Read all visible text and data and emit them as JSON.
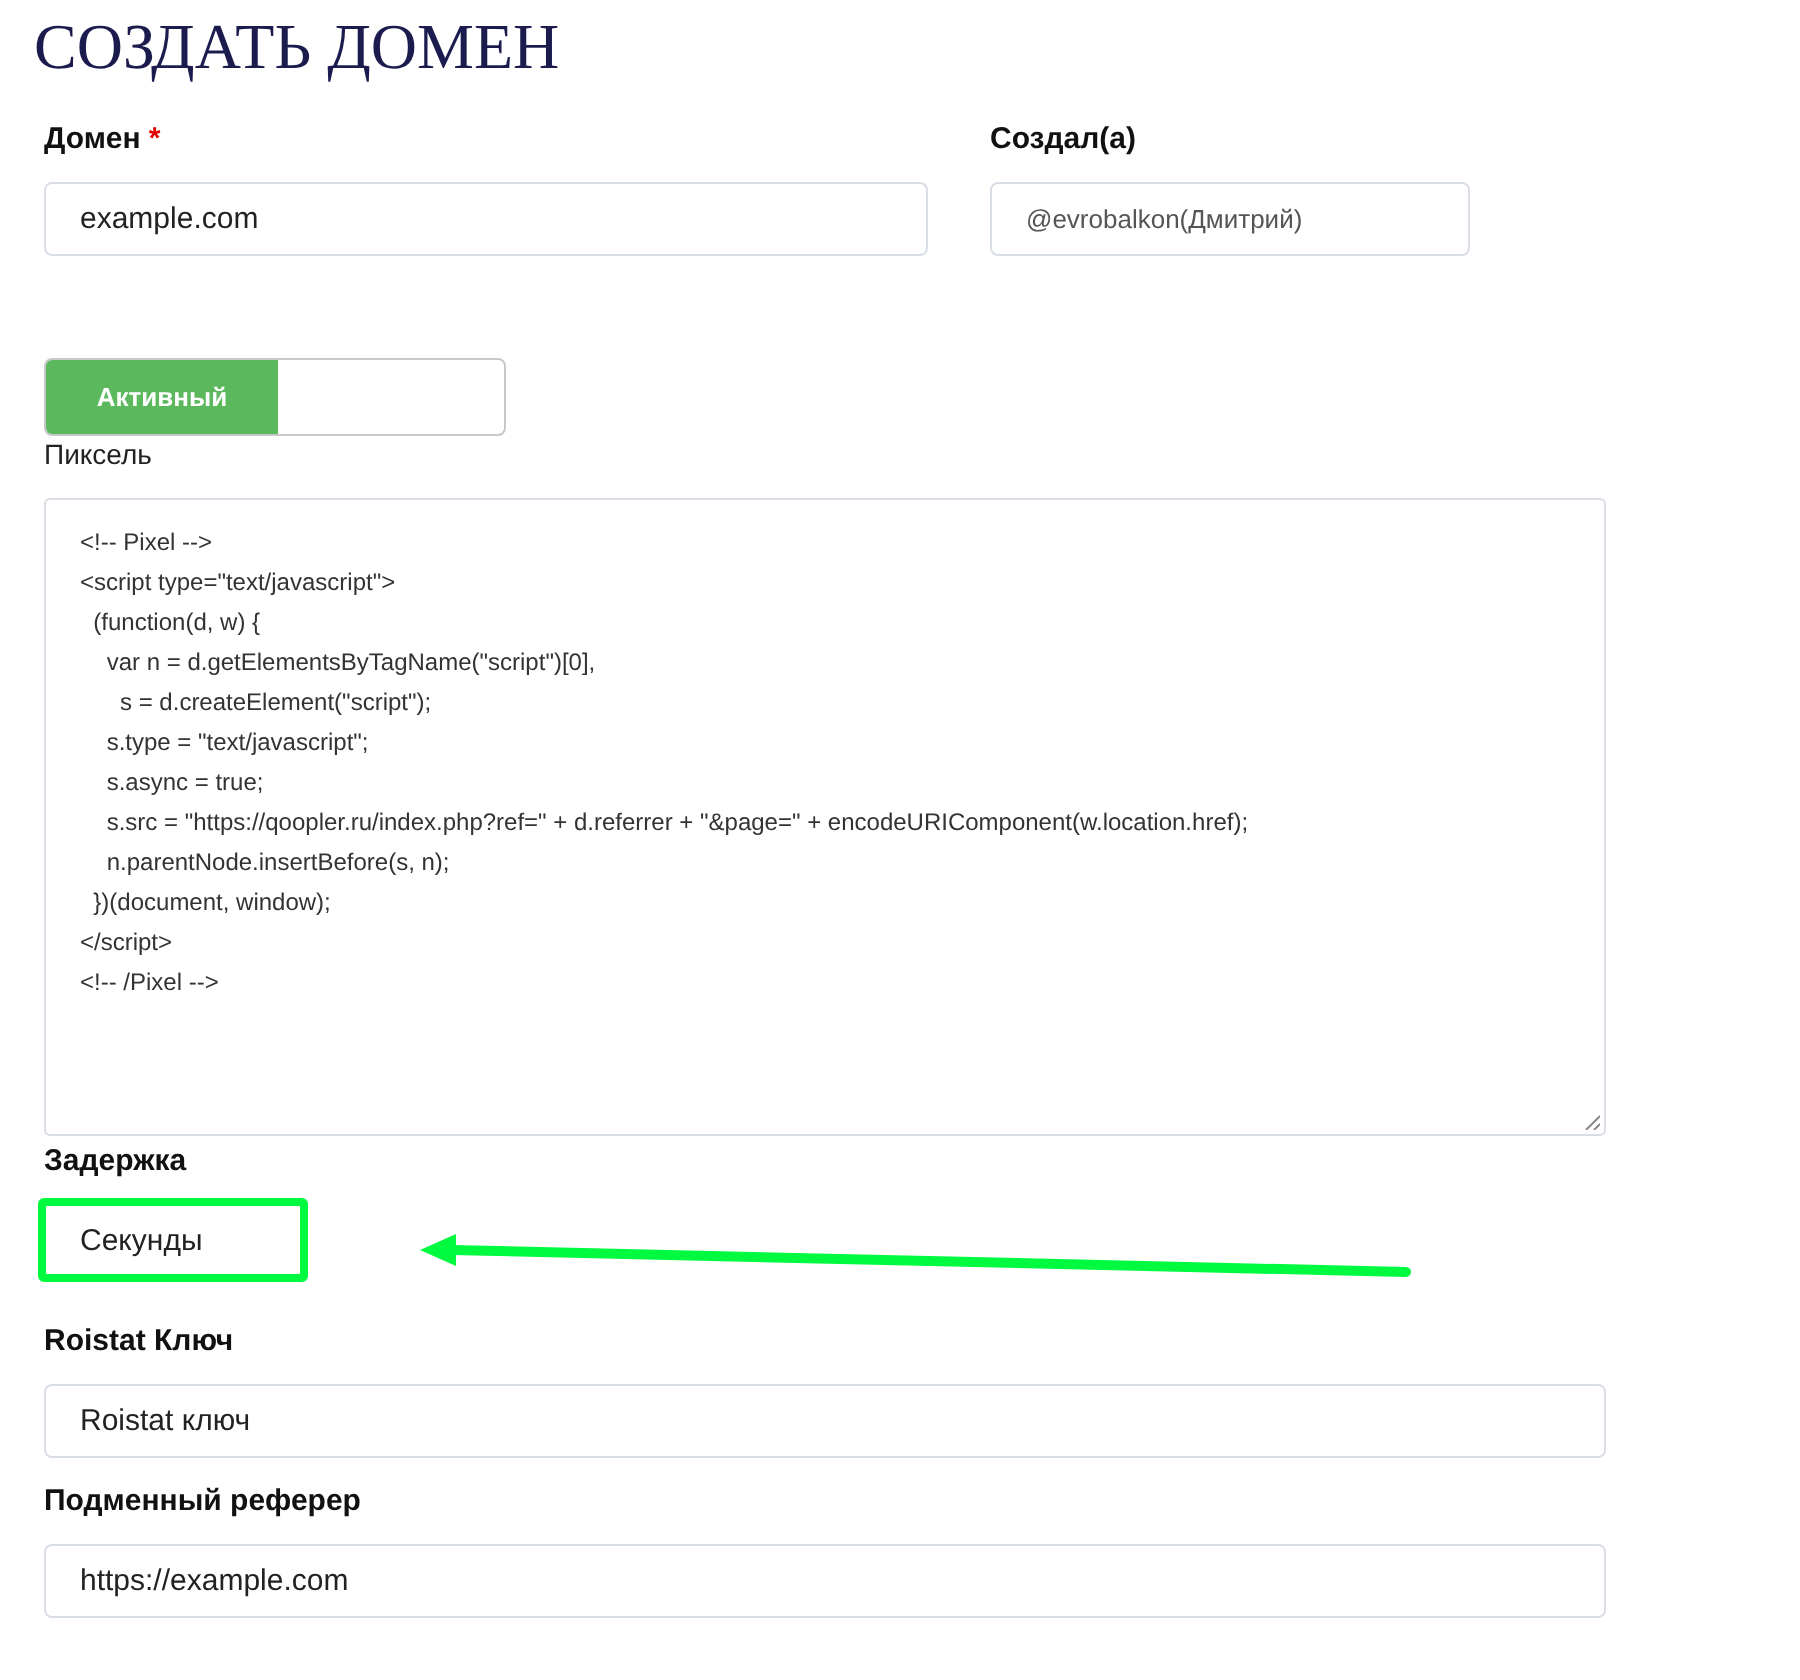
{
  "title": "СОЗДАТЬ ДОМЕН",
  "domain": {
    "label": "Домен",
    "required_mark": "*",
    "value": "example.com"
  },
  "created_by": {
    "label": "Создал(а)",
    "value": "@evrobalkon(Дмитрий)"
  },
  "status_toggle": {
    "label": "Активный",
    "on": true
  },
  "pixel": {
    "label": "Пиксель",
    "lines": [
      "<!-- Pixel -->",
      "<script type=\"text/javascript\">",
      "  (function(d, w) {",
      "    var n = d.getElementsByTagName(\"script\")[0],",
      "      s = d.createElement(\"script\");",
      "    s.type = \"text/javascript\";",
      "    s.async = true;",
      "    s.src = \"https://qoopler.ru/index.php?ref=\" + d.referrer + \"&page=\" + encodeURIComponent(w.location.href);",
      "    n.parentNode.insertBefore(s, n);",
      "  })(document, window);",
      "</script>",
      "<!-- /Pixel -->"
    ]
  },
  "delay": {
    "label": "Задержка",
    "value": "Секунды",
    "highlighted": true
  },
  "roistat_key": {
    "label": "Roistat Ключ",
    "value": "Roistat ключ"
  },
  "referrer": {
    "label": "Подменный реферер",
    "value": "https://example.com"
  }
}
